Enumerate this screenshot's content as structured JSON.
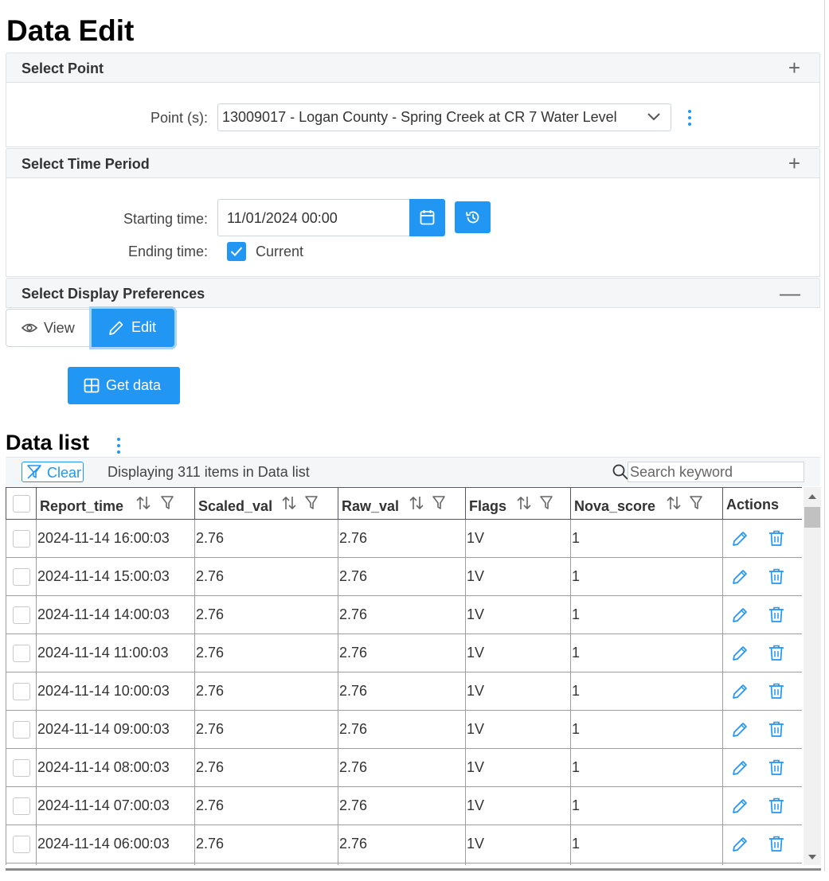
{
  "page": {
    "title": "Data Edit"
  },
  "select_point": {
    "title": "Select Point",
    "toggle": "+",
    "label": "Point (s):",
    "selected": "13009017 - Logan County - Spring Creek at CR 7 Water Level"
  },
  "time_period": {
    "title": "Select Time Period",
    "toggle": "+",
    "start_label": "Starting time:",
    "start_value": "11/01/2024 00:00",
    "end_label": "Ending time:",
    "current_label": "Current",
    "current_checked": true
  },
  "display_prefs": {
    "title": "Select Display Preferences",
    "toggle": "—",
    "view_label": "View",
    "edit_label": "Edit",
    "selected": "Edit"
  },
  "get_data_label": "Get data",
  "data_list": {
    "title": "Data list",
    "clear_label": "Clear",
    "count_text": "Displaying 311 items in Data list",
    "search_placeholder": "Search keyword",
    "columns": [
      "Report_time",
      "Scaled_val",
      "Raw_val",
      "Flags",
      "Nova_score",
      "Actions"
    ],
    "rows": [
      {
        "report_time": "2024-11-14 16:00:03",
        "scaled_val": "2.76",
        "raw_val": "2.76",
        "flags": "1V",
        "nova_score": "1"
      },
      {
        "report_time": "2024-11-14 15:00:03",
        "scaled_val": "2.76",
        "raw_val": "2.76",
        "flags": "1V",
        "nova_score": "1"
      },
      {
        "report_time": "2024-11-14 14:00:03",
        "scaled_val": "2.76",
        "raw_val": "2.76",
        "flags": "1V",
        "nova_score": "1"
      },
      {
        "report_time": "2024-11-14 11:00:03",
        "scaled_val": "2.76",
        "raw_val": "2.76",
        "flags": "1V",
        "nova_score": "1"
      },
      {
        "report_time": "2024-11-14 10:00:03",
        "scaled_val": "2.76",
        "raw_val": "2.76",
        "flags": "1V",
        "nova_score": "1"
      },
      {
        "report_time": "2024-11-14 09:00:03",
        "scaled_val": "2.76",
        "raw_val": "2.76",
        "flags": "1V",
        "nova_score": "1"
      },
      {
        "report_time": "2024-11-14 08:00:03",
        "scaled_val": "2.76",
        "raw_val": "2.76",
        "flags": "1V",
        "nova_score": "1"
      },
      {
        "report_time": "2024-11-14 07:00:03",
        "scaled_val": "2.76",
        "raw_val": "2.76",
        "flags": "1V",
        "nova_score": "1"
      },
      {
        "report_time": "2024-11-14 06:00:03",
        "scaled_val": "2.76",
        "raw_val": "2.76",
        "flags": "1V",
        "nova_score": "1"
      },
      {
        "report_time": "",
        "scaled_val": "",
        "raw_val": "",
        "flags": "",
        "nova_score": ""
      }
    ]
  },
  "colors": {
    "primary": "#2196f3",
    "header_bg": "#f5f6f7",
    "border": "#dee2e6"
  },
  "icons": {
    "point_dropdown": "chevron-down-icon",
    "point_menu": "kebab-menu-icon",
    "calendar": "calendar-icon",
    "history": "history-icon",
    "view": "eye-icon",
    "edit": "pencil-icon",
    "get_data": "table-icon",
    "clear": "filter-off-icon",
    "search": "search-icon",
    "sort": "sort-icon",
    "filter": "filter-icon",
    "row_edit": "pencil-icon",
    "row_delete": "trash-icon"
  }
}
